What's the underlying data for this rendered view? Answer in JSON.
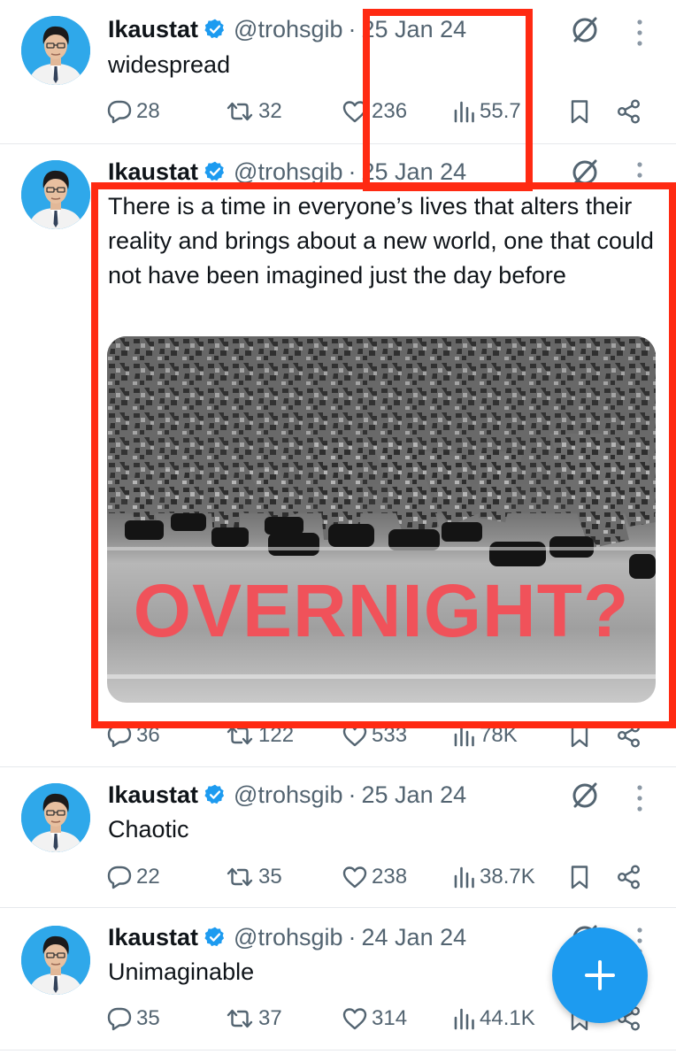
{
  "tweets": [
    {
      "name": "Ikaustat",
      "handle": "@trohsgib",
      "date": "25 Jan 24",
      "text": "widespread",
      "replies": "28",
      "reposts": "32",
      "likes": "236",
      "views": "55.7"
    },
    {
      "name": "Ikaustat",
      "handle": "@trohsgib",
      "date": "25 Jan 24",
      "text": "There is a time in everyone’s lives that alters their reality and brings about a new world, one that could not have been imagined just the day before",
      "media_text": "OVERNIGHT?",
      "replies": "36",
      "reposts": "122",
      "likes": "533",
      "views": "78K"
    },
    {
      "name": "Ikaustat",
      "handle": "@trohsgib",
      "date": "25 Jan 24",
      "text": "Chaotic",
      "replies": "22",
      "reposts": "35",
      "likes": "238",
      "views": "38.7K"
    },
    {
      "name": "Ikaustat",
      "handle": "@trohsgib",
      "date": "24 Jan 24",
      "text": "Unimaginable",
      "replies": "35",
      "reposts": "37",
      "likes": "314",
      "views": "44.1K"
    }
  ],
  "separator": "·",
  "colors": {
    "accent": "#1d9bf0",
    "highlight_box": "#ff2a12",
    "muted": "#536471",
    "media_text": "#f0525a"
  },
  "icons": [
    "verified-badge-icon",
    "grok-icon",
    "more-icon",
    "reply-icon",
    "repost-icon",
    "like-icon",
    "views-icon",
    "bookmark-icon",
    "share-icon",
    "compose-plus-icon"
  ]
}
